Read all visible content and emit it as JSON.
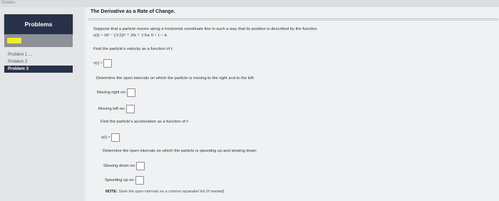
{
  "app": {
    "top_label": "Grades"
  },
  "sidebar": {
    "header": "Problems",
    "items": [
      {
        "label": "Problem 1 ..."
      },
      {
        "label": "Problem 2"
      },
      {
        "label": "Problem 3"
      }
    ],
    "progress_color": "#f2ea2c",
    "header_color": "#27324a"
  },
  "main": {
    "title": "The Derivative as a Rate of Change.",
    "intro": "Suppose that a particle moves along a horizontal coordinate line in such a way that its position is described by the function",
    "function": "s(t) = 6t³ − (3/2)t² + 26t + 3  for  0 < t < 4.",
    "q1": "Find the particle's velocity as a function of t:",
    "v_label": "v(t) =",
    "q2": "Determine the open intervals on which the particle is moving to the right and to the left:",
    "right_label": "Moving right on:",
    "left_label": "Moving left on:",
    "q3": "Find the particle's acceleration as a function of t:",
    "a_label": "a(t) =",
    "q4": "Determine the open intervals on which the particle is speeding up and slowing down:",
    "slow_label": "Slowing down on:",
    "speed_label": "Speeding up on:",
    "note_bold": "NOTE:",
    "note_text": "State the open intervals as a comma separated list (if needed)."
  },
  "inputs": {
    "v": "",
    "right": "",
    "left": "",
    "a": "",
    "slow": "",
    "speed": ""
  }
}
